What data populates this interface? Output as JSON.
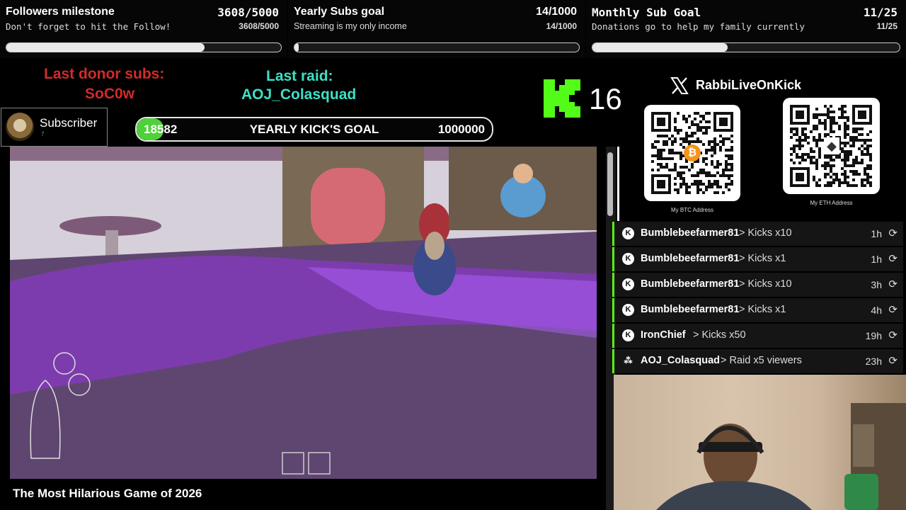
{
  "goals": [
    {
      "title": "Followers milestone",
      "title_value": "3608/5000",
      "subtitle": "Don't forget to hit the Follow!",
      "subtitle_value": "3608/5000",
      "progress": 0.7216
    },
    {
      "title": "Yearly Subs goal",
      "title_value": "14/1000",
      "subtitle": "Streaming is my only income",
      "subtitle_value": "14/1000",
      "progress": 0.014
    },
    {
      "title": "Monthly Sub Goal",
      "title_value": "11/25",
      "subtitle": "Donations go to help my family currently",
      "subtitle_value": "11/25",
      "progress": 0.44
    }
  ],
  "donor": {
    "label": "Last donor subs:",
    "name": "SoC0w"
  },
  "raid": {
    "label": "Last raid:",
    "name": "AOJ_Colasquad"
  },
  "subscriber": {
    "label": "Subscriber",
    "count": "7"
  },
  "kicks_goal": {
    "current": "18582",
    "label": "YEARLY KICK'S GOAL",
    "target": "1000000",
    "progress": 0.0186
  },
  "kick_counter": "16",
  "social": {
    "handle": "RabbiLiveOnKick",
    "icon": "x-logo-icon"
  },
  "qr": [
    {
      "caption": "My BTC Address",
      "icon": "bitcoin-icon"
    },
    {
      "caption": "My ETH Address",
      "icon": "ethereum-icon"
    }
  ],
  "events": [
    {
      "user": "Bumblebeefarmer81",
      "action": "> Kicks x10",
      "time": "1h",
      "icon": "kick-icon"
    },
    {
      "user": "Bumblebeefarmer81",
      "action": "> Kicks x1",
      "time": "1h",
      "icon": "kick-icon"
    },
    {
      "user": "Bumblebeefarmer81",
      "action": "> Kicks x10",
      "time": "3h",
      "icon": "kick-icon"
    },
    {
      "user": "Bumblebeefarmer81",
      "action": "> Kicks x1",
      "time": "4h",
      "icon": "kick-icon"
    },
    {
      "user": "IronChief",
      "action": "> Kicks x50",
      "time": "19h",
      "icon": "kick-icon"
    },
    {
      "user": "AOJ_Colasquad",
      "action": "> Raid x5 viewers",
      "time": "23h",
      "icon": "raid-icon"
    }
  ],
  "game_title": "The Most Hilarious Game of 2026",
  "colors": {
    "kick_green": "#53fc18",
    "donor_red": "#d42a2a",
    "raid_cyan": "#3fe0c6"
  }
}
